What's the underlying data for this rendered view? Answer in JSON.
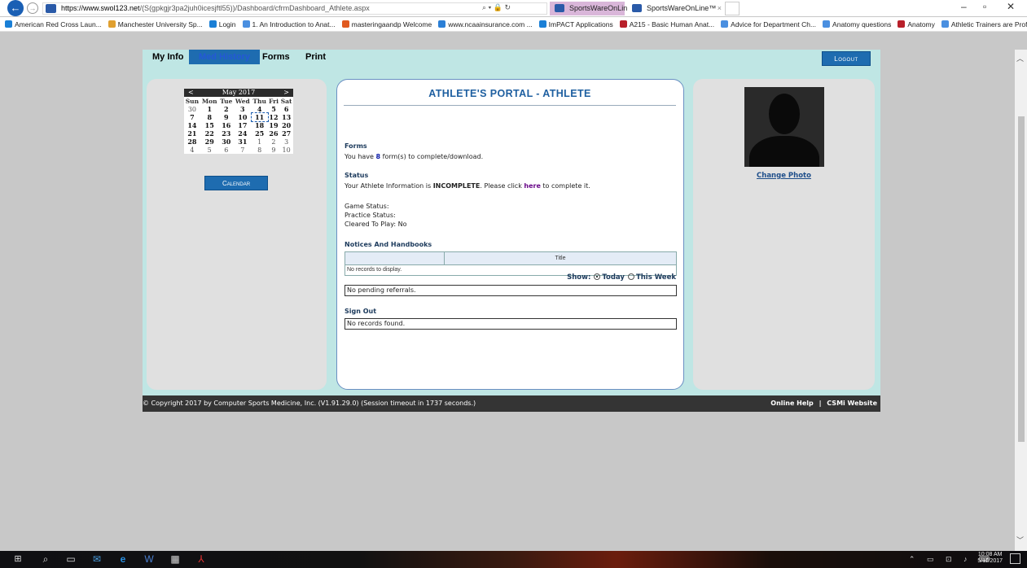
{
  "browser": {
    "url_host": "https://www.swol123.net",
    "url_path": "/(S(gpkgjr3pa2juh0icesjftl55))/Dashboard/cfrmDashboard_Athlete.aspx",
    "search_glyph": "⌕ ▾ 🔒 ↻",
    "tabs": [
      "SportsWareOnLine™",
      "SportsWareOnLine™"
    ],
    "tab_close": "×",
    "favorites": [
      "American Red Cross Laun...",
      "Manchester University Sp...",
      "Login",
      "1. An Introduction to Anat...",
      "masteringaandp Welcome",
      "www.ncaainsurance.com ...",
      "ImPACT Applications",
      "A215 - Basic Human Anat...",
      "Advice for Department Ch...",
      "Anatomy questions",
      "Anatomy",
      "Athletic Trainers are Profe..."
    ],
    "favorite_colors": [
      "#1a7fd6",
      "#e0a030",
      "#1a7fd6",
      "#4a8fe0",
      "#e05a20",
      "#2b7fd6",
      "#1a7fd6",
      "#b8202a",
      "#4a8fe0",
      "#4a8fe0",
      "#b8202a",
      "#4a8fe0"
    ]
  },
  "nav": {
    "items": [
      "My Info",
      "Med History",
      "Forms",
      "Print"
    ],
    "active_index": 1,
    "logout_label": "Logout"
  },
  "calendar": {
    "prev": "<",
    "next": ">",
    "month_label": "May 2017",
    "weekdays": [
      "Sun",
      "Mon",
      "Tue",
      "Wed",
      "Thu",
      "Fri",
      "Sat"
    ],
    "weeks": [
      [
        "30",
        "1",
        "2",
        "3",
        "4",
        "5",
        "6"
      ],
      [
        "7",
        "8",
        "9",
        "10",
        "11",
        "12",
        "13"
      ],
      [
        "14",
        "15",
        "16",
        "17",
        "18",
        "19",
        "20"
      ],
      [
        "21",
        "22",
        "23",
        "24",
        "25",
        "26",
        "27"
      ],
      [
        "28",
        "29",
        "30",
        "31",
        "1",
        "2",
        "3"
      ],
      [
        "4",
        "5",
        "6",
        "7",
        "8",
        "9",
        "10"
      ]
    ],
    "today": "11",
    "button_label": "Calendar"
  },
  "portal": {
    "title": "ATHLETE'S PORTAL - ATHLETE",
    "forms_heading": "Forms",
    "forms_text_pre": "You have",
    "forms_count": "8",
    "forms_text_post": "form(s) to complete/download.",
    "status_heading": "Status",
    "status_text_pre": "Your Athlete Information is",
    "status_value": "INCOMPLETE",
    "status_text_mid": ". Please click",
    "status_link": "here",
    "status_text_post": "to complete it.",
    "game_status": "Game Status:",
    "practice_status": "Practice Status:",
    "cleared_label": "Cleared To Play:",
    "cleared_value": "No",
    "notices_heading": "Notices And Handbooks",
    "grid_col_title": "Title",
    "grid_empty": "No records to display.",
    "show_label": "Show:",
    "show_today": "Today",
    "show_week": "This Week",
    "referrals_text": "No pending referrals.",
    "signout_heading": "Sign Out",
    "signout_text": "No records found."
  },
  "profile": {
    "change_photo": "Change Photo"
  },
  "footer": {
    "copyright": "© Copyright 2017 by Computer Sports Medicine, Inc. (V1.91.29.0) (Session timeout in 1737 seconds.)",
    "online_help": "Online Help",
    "separator": "|",
    "csmi_website": "CSMi Website"
  },
  "taskbar": {
    "time": "10:08 AM",
    "date": "5/11/2017"
  }
}
